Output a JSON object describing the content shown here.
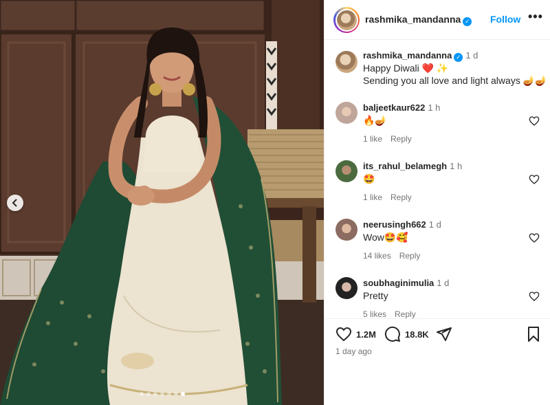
{
  "post": {
    "username": "rashmika_mandanna",
    "follow_label": "Follow",
    "more_label": "•••",
    "caption_time": "1 d",
    "caption_line1": "Happy Diwali ❤️ ✨",
    "caption_line2": "Sending you all love and light always 🪔🪔",
    "carousel": {
      "total": 7,
      "active_index": 6
    }
  },
  "comments": [
    {
      "username": "baljeetkaur622",
      "time": "1 h",
      "text": "🔥🪔",
      "likes": "1 like",
      "reply": "Reply"
    },
    {
      "username": "its_rahul_belamegh",
      "time": "1 h",
      "text": "🤩",
      "likes": "1 like",
      "reply": "Reply"
    },
    {
      "username": "neerusingh662",
      "time": "1 d",
      "text": "Wow🤩🥰",
      "likes": "14 likes",
      "reply": "Reply"
    },
    {
      "username": "soubhaginimulia",
      "time": "1 d",
      "text": "Pretty",
      "likes": "5 likes",
      "reply": "Reply"
    }
  ],
  "stats": {
    "likes": "1.2M",
    "comments": "18.8K",
    "posted": "1 day ago"
  },
  "icons": {
    "verified": "verified-badge-icon",
    "like": "heart-icon",
    "comment": "comment-icon",
    "share": "share-icon",
    "save": "bookmark-icon",
    "prev": "chevron-left-icon"
  },
  "colors": {
    "accent": "#0095f6",
    "text": "#262626",
    "muted": "#737373"
  }
}
